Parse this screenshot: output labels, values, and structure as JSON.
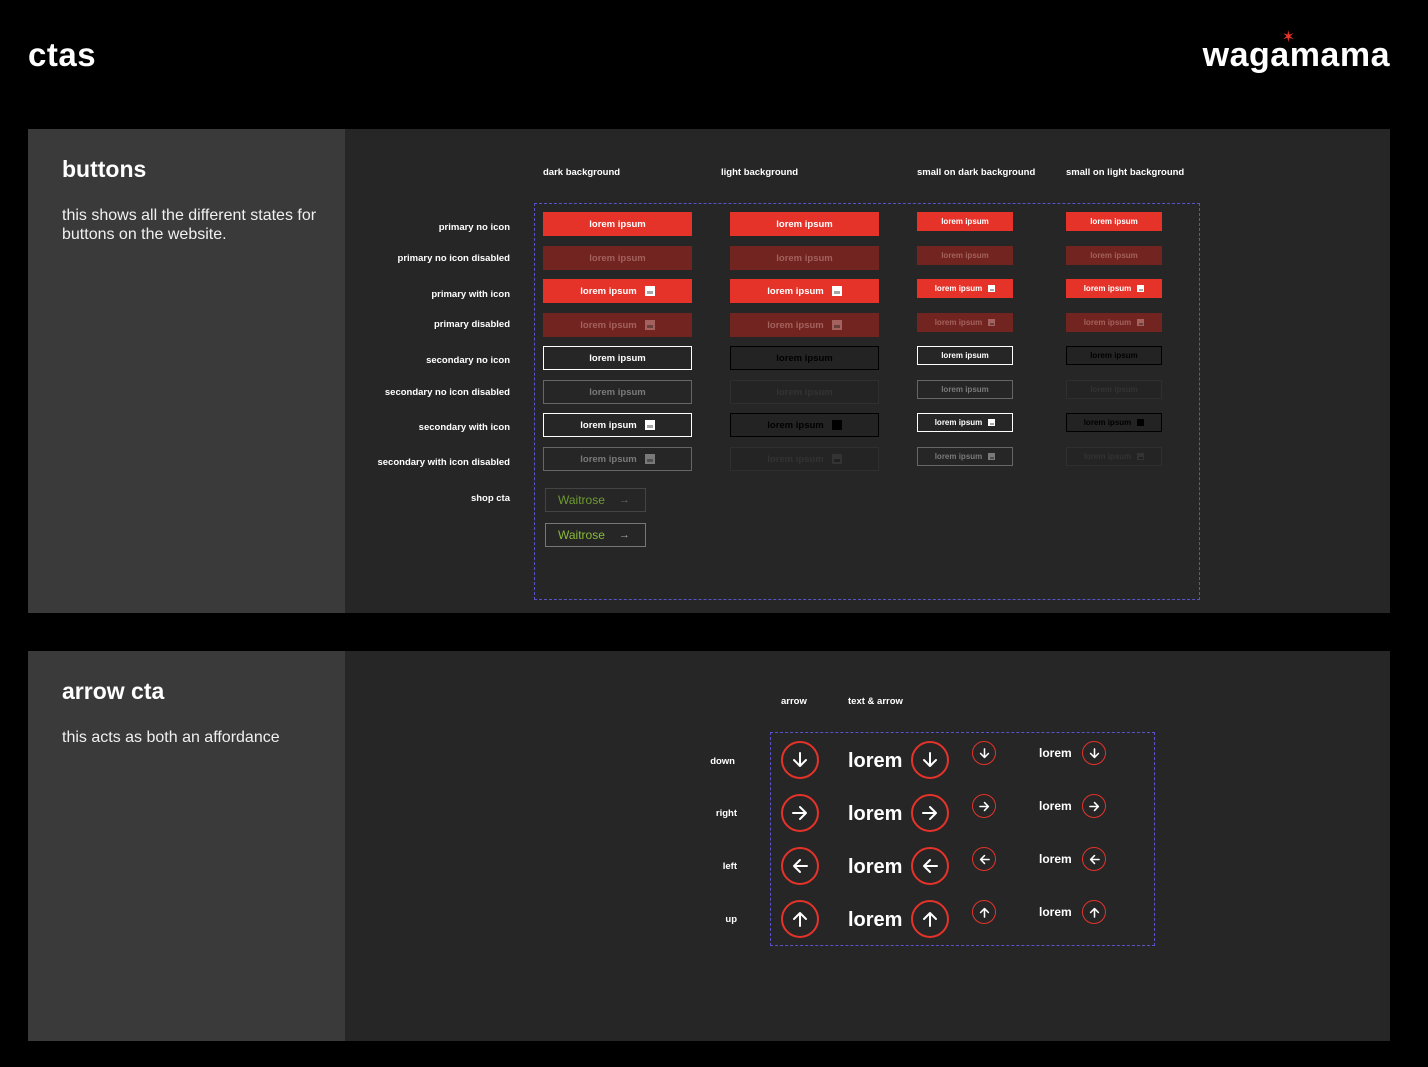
{
  "header": {
    "title": "ctas",
    "logo": "wagamama"
  },
  "buttons_section": {
    "heading": "buttons",
    "description": "this shows all the different states for buttons on the website.",
    "columns": [
      "dark background",
      "light background",
      "small on dark background",
      "small on light background"
    ],
    "rows": [
      "primary no icon",
      "primary no icon disabled",
      "primary with icon",
      "primary disabled",
      "secondary no icon",
      "secondary no icon disabled",
      "secondary with icon",
      "secondary with icon disabled",
      "shop cta"
    ],
    "button_label": "lorem ipsum",
    "shop_label": "Waitrose"
  },
  "arrow_section": {
    "heading": "arrow cta",
    "description": "this acts as both an affordance",
    "columns": [
      "arrow",
      "text & arrow"
    ],
    "rows": [
      "down",
      "right",
      "left",
      "up"
    ],
    "text_label": "lorem"
  },
  "colors": {
    "accent": "#e5332a",
    "disabled": "#722420",
    "shop_green": "#8ab83a",
    "dashed_outline": "#5a52c9"
  }
}
